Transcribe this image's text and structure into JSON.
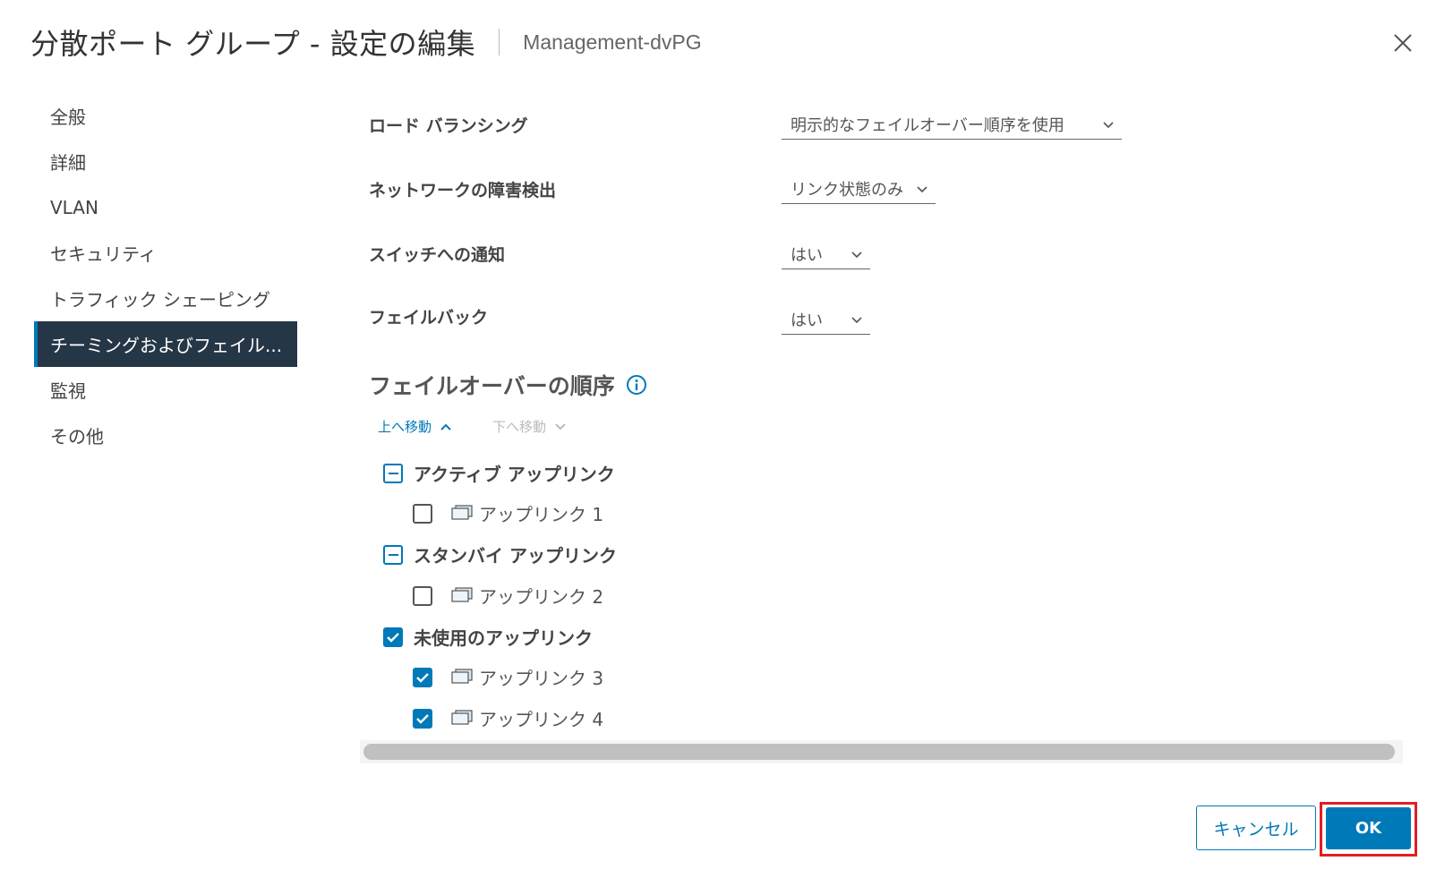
{
  "header": {
    "title": "分散ポート グループ - 設定の編集",
    "subtitle": "Management-dvPG"
  },
  "nav": {
    "items": [
      {
        "label": "全般"
      },
      {
        "label": "詳細"
      },
      {
        "label": "VLAN"
      },
      {
        "label": "セキュリティ"
      },
      {
        "label": "トラフィック シェーピング"
      },
      {
        "label": "チーミングおよびフェイル..."
      },
      {
        "label": "監視"
      },
      {
        "label": "その他"
      }
    ],
    "active_index": 5
  },
  "settings": {
    "load_balancing": {
      "label": "ロード バランシング",
      "value": "明示的なフェイルオーバー順序を使用"
    },
    "network_failure_detection": {
      "label": "ネットワークの障害検出",
      "value": "リンク状態のみ"
    },
    "notify_switches": {
      "label": "スイッチへの通知",
      "value": "はい"
    },
    "failback": {
      "label": "フェイルバック",
      "value": "はい"
    }
  },
  "failover_order": {
    "title": "フェイルオーバーの順序",
    "move_up": "上へ移動",
    "move_down": "下へ移動",
    "groups": {
      "active": {
        "label": "アクティブ アップリンク",
        "state": "indeterminate",
        "uplinks": [
          {
            "label": "アップリンク 1",
            "checked": false
          }
        ]
      },
      "standby": {
        "label": "スタンバイ アップリンク",
        "state": "indeterminate",
        "uplinks": [
          {
            "label": "アップリンク 2",
            "checked": false
          }
        ]
      },
      "unused": {
        "label": "未使用のアップリンク",
        "state": "checked",
        "uplinks": [
          {
            "label": "アップリンク 3",
            "checked": true
          },
          {
            "label": "アップリンク 4",
            "checked": true
          }
        ]
      }
    }
  },
  "footer": {
    "cancel_label": "キャンセル",
    "ok_label": "OK"
  },
  "colors": {
    "accent": "#0079b8",
    "nav_active_bg": "#253647",
    "highlight": "#e01e24"
  },
  "icons": {
    "close": "close-icon",
    "chevron": "chevron-down-icon",
    "info": "info-icon",
    "uplink": "uplink-icon"
  }
}
